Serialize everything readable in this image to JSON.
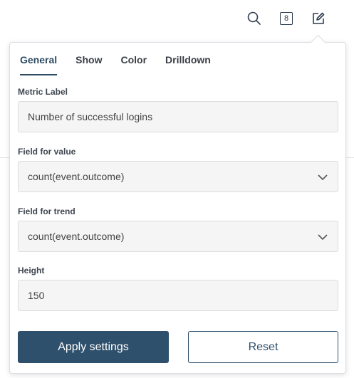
{
  "toolbar": {
    "search_icon": "search-icon",
    "count_badge": "8",
    "edit_icon": "edit-icon"
  },
  "tabs": [
    {
      "label": "General",
      "active": true
    },
    {
      "label": "Show",
      "active": false
    },
    {
      "label": "Color",
      "active": false
    },
    {
      "label": "Drilldown",
      "active": false
    }
  ],
  "form": {
    "metric_label": {
      "label": "Metric Label",
      "value": "Number of successful logins"
    },
    "field_value": {
      "label": "Field for value",
      "value": "count(event.outcome)"
    },
    "field_trend": {
      "label": "Field for trend",
      "value": "count(event.outcome)"
    },
    "height": {
      "label": "Height",
      "value": "150"
    }
  },
  "buttons": {
    "apply": "Apply settings",
    "reset": "Reset"
  },
  "colors": {
    "accent": "#2f506c",
    "active_tab": "#2d4b63"
  }
}
